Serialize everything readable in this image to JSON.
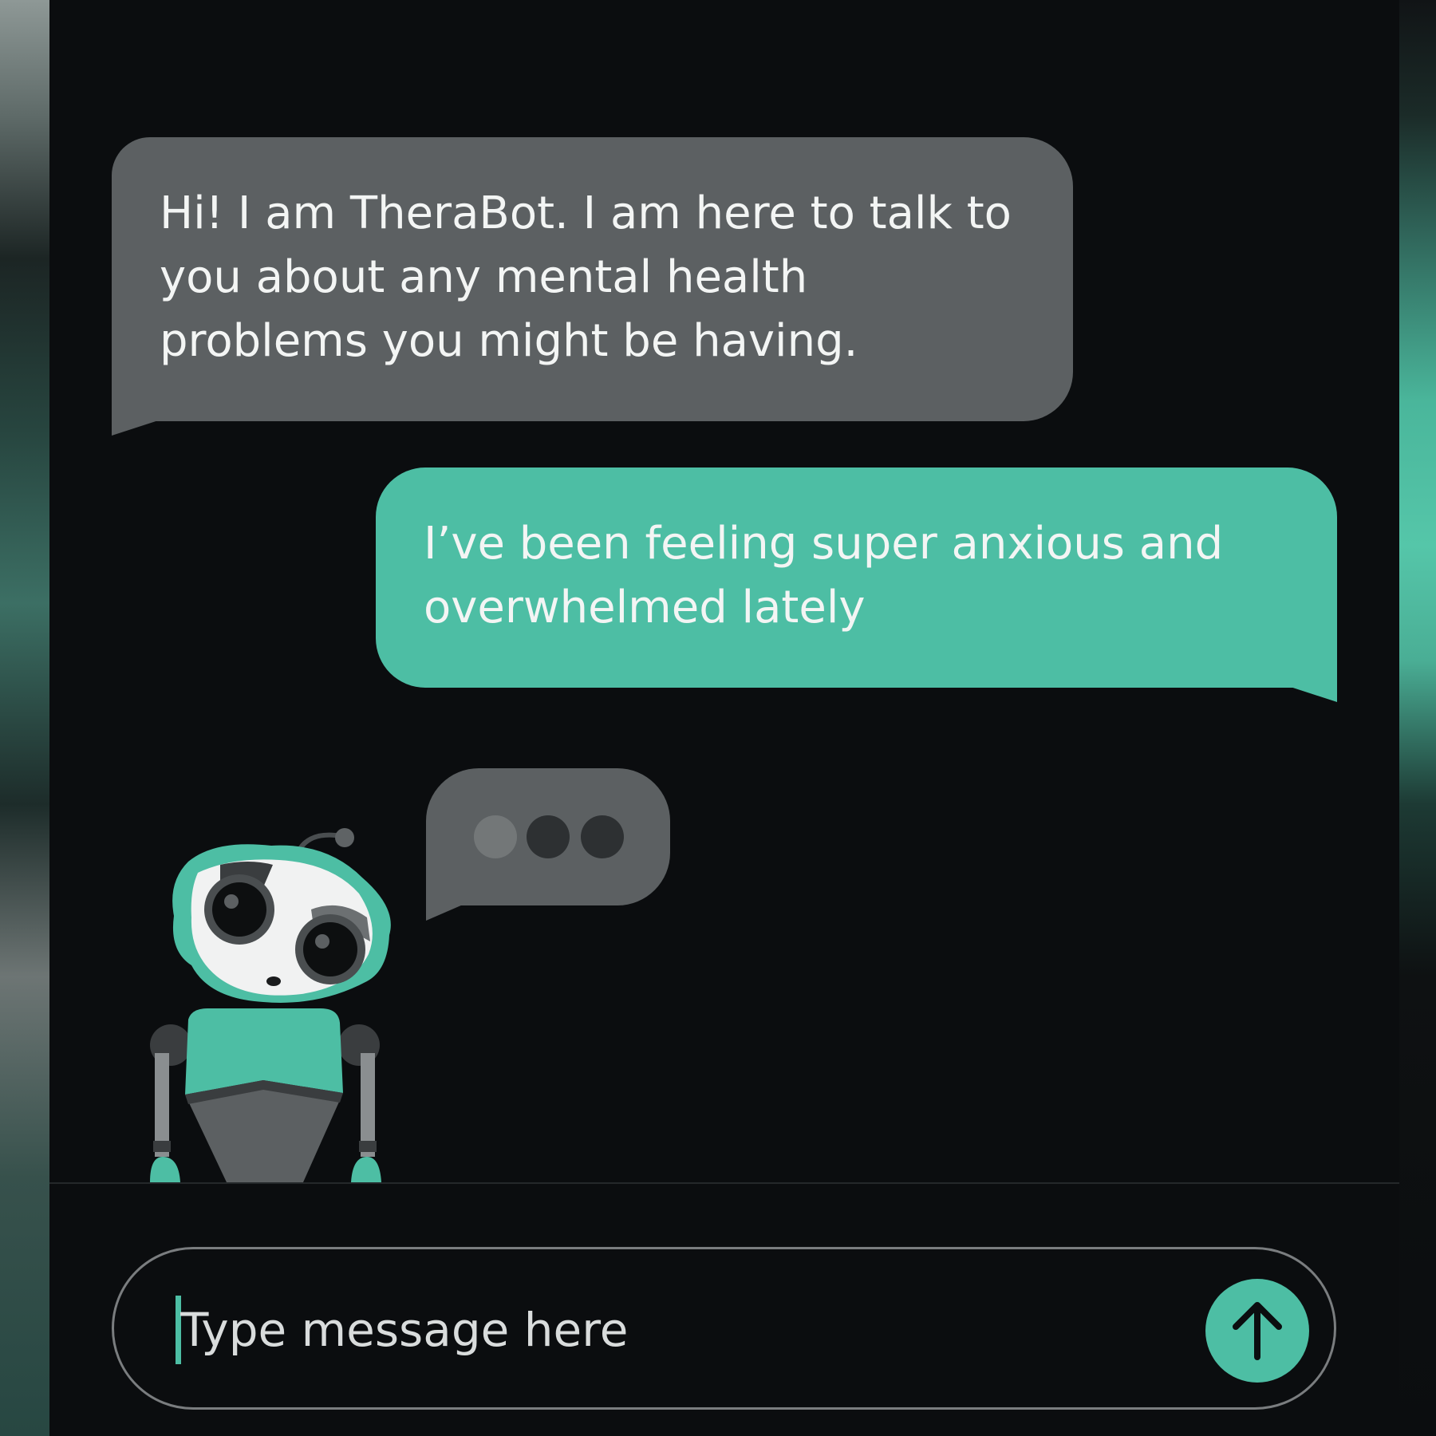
{
  "colors": {
    "background": "#0b0d0f",
    "bot_bubble": "#5c6062",
    "user_bubble": "#4dbea4",
    "accent": "#4dbea4",
    "text": "#f3f5f4"
  },
  "conversation": {
    "messages": [
      {
        "sender": "bot",
        "lines": [
          "Hi! I am TheraBot. I am here to talk to",
          "you about any mental health",
          "problems you might be having."
        ]
      },
      {
        "sender": "user",
        "lines": [
          "I’ve been feeling super anxious and",
          "overwhelmed lately"
        ]
      }
    ],
    "typing_indicator": {
      "dots": 3,
      "active_dot": 1
    }
  },
  "bot_avatar": {
    "icon": "robot-mascot-icon"
  },
  "composer": {
    "placeholder": "Type message here",
    "value": "",
    "send_icon": "arrow-up-icon"
  }
}
